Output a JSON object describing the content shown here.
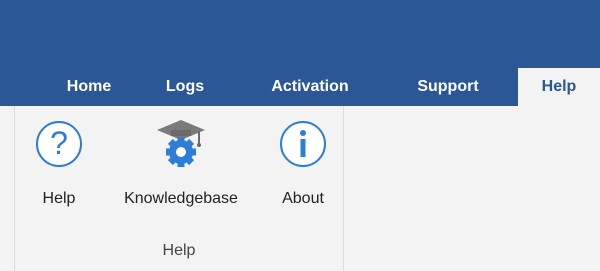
{
  "colors": {
    "titlebar": "#2b5797",
    "ribbon_bg": "#f3f3f3",
    "icon_blue": "#2e7dd7",
    "icon_gray": "#7a7a7a"
  },
  "tabs": [
    {
      "label": "Home"
    },
    {
      "label": "Logs"
    },
    {
      "label": "Activation"
    },
    {
      "label": "Support"
    },
    {
      "label": "Help",
      "active": true
    }
  ],
  "ribbon": {
    "group_label": "Help",
    "buttons": [
      {
        "label": "Help",
        "icon": "question-icon"
      },
      {
        "label": "Knowledgebase",
        "icon": "graduation-gear-icon"
      },
      {
        "label": "About",
        "icon": "info-icon"
      }
    ]
  }
}
